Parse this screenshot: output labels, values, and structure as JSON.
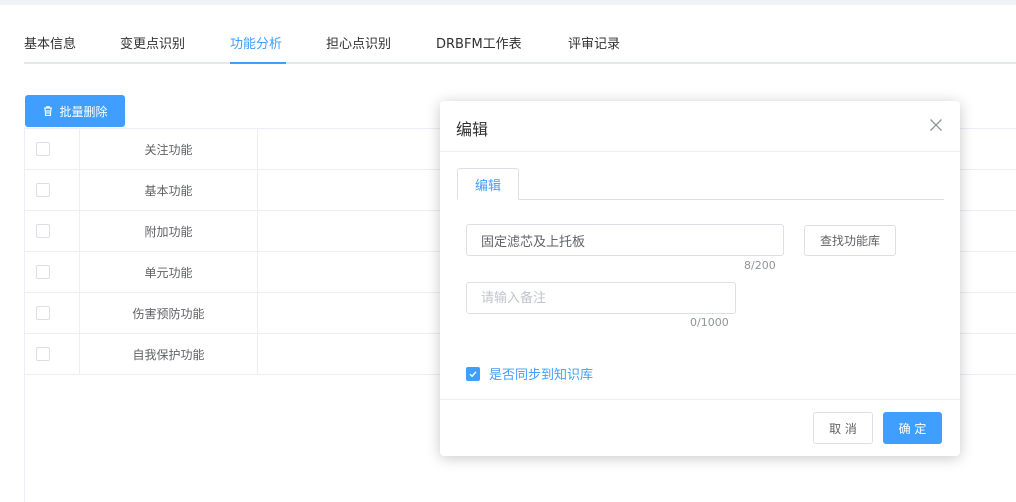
{
  "tabs": [
    {
      "label": "基本信息",
      "active": false
    },
    {
      "label": "变更点识别",
      "active": false
    },
    {
      "label": "功能分析",
      "active": true
    },
    {
      "label": "担心点识别",
      "active": false
    },
    {
      "label": "DRBFM工作表",
      "active": false
    },
    {
      "label": "评审记录",
      "active": false
    }
  ],
  "toolbar": {
    "batch_delete_label": "批量删除",
    "batch_delete_icon": "trash-icon"
  },
  "table": {
    "header": "关注功能",
    "rows": [
      "基本功能",
      "附加功能",
      "单元功能",
      "伤害预防功能",
      "自我保护功能"
    ]
  },
  "dialog": {
    "title": "编辑",
    "tab_label": "编辑",
    "function_input": {
      "value": "固定滤芯及上托板",
      "count": "8/200"
    },
    "search_library_label": "查找功能库",
    "remark_input": {
      "value": "",
      "placeholder": "请输入备注",
      "count": "0/1000"
    },
    "sync_checkbox": {
      "label": "是否同步到知识库",
      "checked": true
    },
    "cancel_label": "取 消",
    "confirm_label": "确 定"
  },
  "colors": {
    "accent": "#409eff",
    "border": "#dcdfe6",
    "text": "#303133",
    "muted": "#909399"
  }
}
